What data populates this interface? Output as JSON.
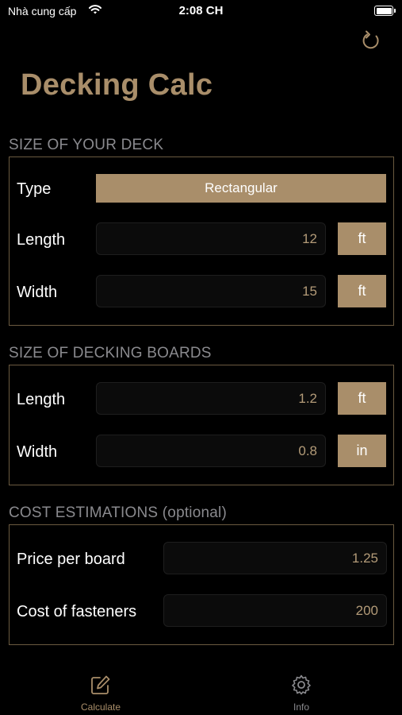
{
  "status_bar": {
    "carrier": "Nhà cung cấp",
    "time": "2:08 CH"
  },
  "header": {
    "title": "Decking Calc"
  },
  "deck": {
    "section_title": "SIZE OF YOUR DECK",
    "type_label": "Type",
    "type_value": "Rectangular",
    "length_label": "Length",
    "length_value": "12",
    "length_unit": "ft",
    "width_label": "Width",
    "width_value": "15",
    "width_unit": "ft"
  },
  "boards": {
    "section_title": "SIZE OF DECKING BOARDS",
    "length_label": "Length",
    "length_value": "1.2",
    "length_unit": "ft",
    "width_label": "Width",
    "width_value": "0.8",
    "width_unit": "in"
  },
  "cost": {
    "section_title": "COST ESTIMATIONS (optional)",
    "price_label": "Price per board",
    "price_value": "1.25",
    "fasteners_label": "Cost of fasteners",
    "fasteners_value": "200"
  },
  "tabs": [
    {
      "label": "Calculate",
      "icon": "pencil-square-icon",
      "active": true
    },
    {
      "label": "Info",
      "icon": "gear-icon",
      "active": false
    }
  ],
  "colors": {
    "accent": "#a98e6a",
    "border": "#6b5a40",
    "background": "#000000"
  }
}
